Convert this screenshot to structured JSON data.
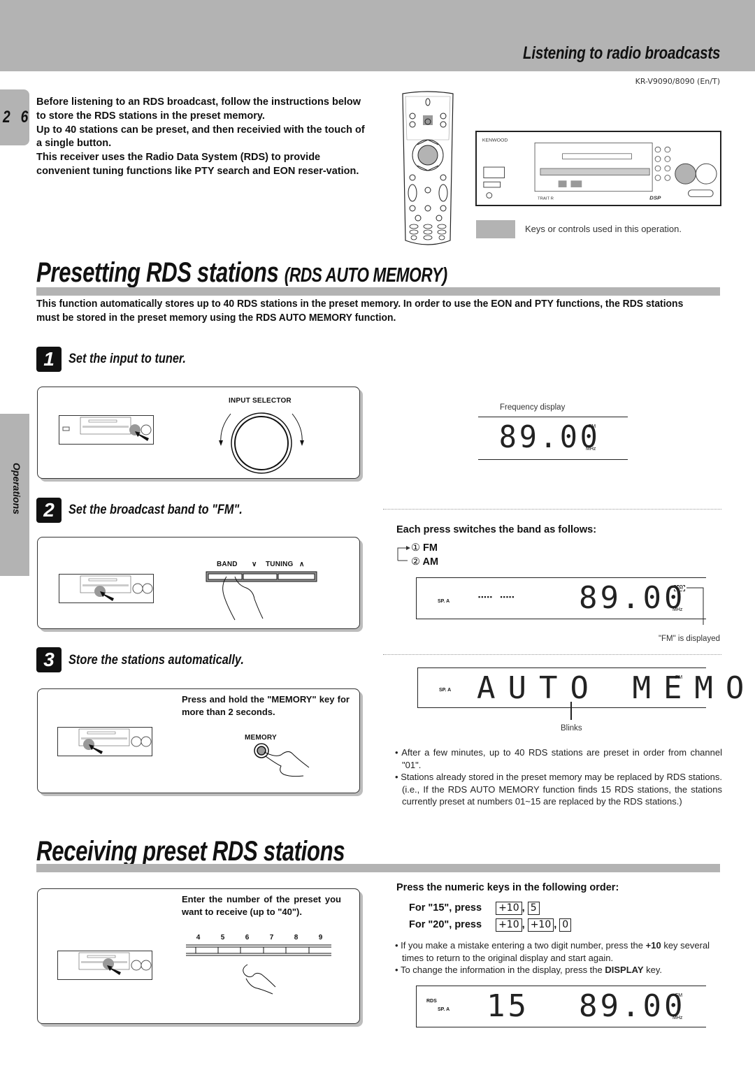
{
  "header": {
    "section_title": "Listening to radio broadcasts",
    "model": "KR-V9090/8090 (En/T)",
    "page_number": "2 6"
  },
  "intro": {
    "paragraphs": [
      "Before listening to an RDS broadcast, follow the instructions below to store the RDS stations in the preset memory.",
      "Up to 40 stations can be preset, and then receivied with the touch of a single button.",
      "This receiver uses the Radio Data System (RDS) to provide convenient tuning functions like PTY search and EON reser-vation."
    ]
  },
  "legend": {
    "text": "Keys or controls used in this operation."
  },
  "side_tab": {
    "label": "Operations"
  },
  "section1": {
    "title_main": "Presetting RDS stations",
    "title_sub": "(RDS AUTO MEMORY)",
    "lead": "This function automatically stores up to 40 RDS stations in the preset memory. In order to use the EON and PTY functions, the RDS stations must be stored in the preset memory using the RDS AUTO MEMORY function.",
    "steps": [
      {
        "number": "1",
        "text": "Set the input to tuner.",
        "control_label": "INPUT SELECTOR",
        "display_caption": "Frequency display",
        "display_value": "89.00",
        "display_band": "FM",
        "display_unit": "MHz"
      },
      {
        "number": "2",
        "text": "Set the broadcast band to \"FM\".",
        "control_labels": [
          "BAND",
          "TUNING"
        ],
        "band_heading": "Each press switches the band as follows:",
        "band_options": [
          {
            "index": "①",
            "label": "FM"
          },
          {
            "index": "②",
            "label": "AM"
          }
        ],
        "display_indicator": "SP. A",
        "display_value": "89.00",
        "display_band": "FM",
        "display_unit": "MHz",
        "display_note": "\"FM\" is displayed"
      },
      {
        "number": "3",
        "text": "Store the stations automatically.",
        "instruction": "Press and hold the \"MEMORY\" key for more than 2 seconds.",
        "control_label": "MEMORY",
        "display_indicator": "SP. A",
        "display_value": "AUTO MEMO",
        "display_band": "FM",
        "display_note": "Blinks",
        "notes": [
          "After a few minutes, up to 40 RDS stations are preset in order from channel \"01\".",
          "Stations already stored in the preset memory may be replaced by RDS stations. (i.e., If the RDS AUTO MEMORY function finds 15 RDS stations, the stations currently preset at numbers 01~15 are replaced by the RDS stations.)"
        ]
      }
    ]
  },
  "section2": {
    "title": "Receiving preset RDS stations",
    "instruction": "Enter the number of the preset you want to receive (up to \"40\").",
    "keys": [
      "4",
      "5",
      "6",
      "7",
      "8",
      "9"
    ],
    "order_heading": "Press the numeric keys in the following order:",
    "examples": [
      {
        "label": "For \"15\", press",
        "keys": [
          "+10",
          "5"
        ]
      },
      {
        "label": "For \"20\", press",
        "keys": [
          "+10",
          "+10",
          "0"
        ]
      }
    ],
    "notes": [
      {
        "pre": "If you make a mistake entering a two digit number, press the ",
        "bold": "+10",
        "post": " key several times to return to the original display and start again."
      },
      {
        "pre": "To change the information in the display, press the ",
        "bold": "DISPLAY",
        "post": " key."
      }
    ],
    "display_rds": "RDS",
    "display_indicator": "SP. A",
    "display_preset": "15",
    "display_value": "89.00",
    "display_band": "FM",
    "display_unit": "MHz"
  },
  "colors": {
    "tab_gray": "#b3b3b3",
    "ink": "#111111",
    "highlight": "#999999"
  }
}
